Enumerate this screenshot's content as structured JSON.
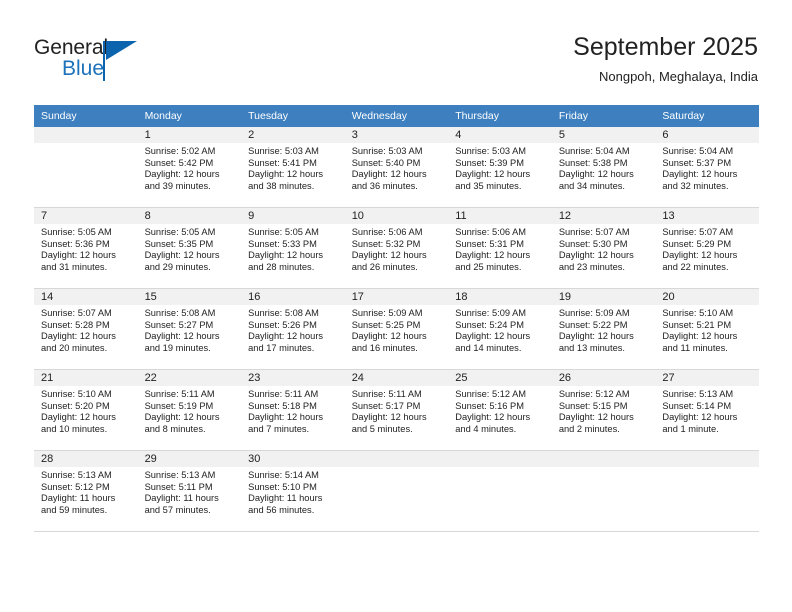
{
  "brand": {
    "name_part1": "General",
    "name_part2": "Blue",
    "accent_color": "#0b64ad",
    "logo_icon": "triangle-flag-icon"
  },
  "header": {
    "title": "September 2025",
    "location": "Nongpoh, Meghalaya, India"
  },
  "calendar": {
    "header_bg": "#3d7fbf",
    "daynum_bg": "#f1f1f1",
    "weekday_headers": [
      "Sunday",
      "Monday",
      "Tuesday",
      "Wednesday",
      "Thursday",
      "Friday",
      "Saturday"
    ],
    "weeks": [
      [
        {
          "day": "",
          "sunrise": "",
          "sunset": "",
          "daylight_line1": "",
          "daylight_line2": ""
        },
        {
          "day": "1",
          "sunrise": "Sunrise: 5:02 AM",
          "sunset": "Sunset: 5:42 PM",
          "daylight_line1": "Daylight: 12 hours",
          "daylight_line2": "and 39 minutes."
        },
        {
          "day": "2",
          "sunrise": "Sunrise: 5:03 AM",
          "sunset": "Sunset: 5:41 PM",
          "daylight_line1": "Daylight: 12 hours",
          "daylight_line2": "and 38 minutes."
        },
        {
          "day": "3",
          "sunrise": "Sunrise: 5:03 AM",
          "sunset": "Sunset: 5:40 PM",
          "daylight_line1": "Daylight: 12 hours",
          "daylight_line2": "and 36 minutes."
        },
        {
          "day": "4",
          "sunrise": "Sunrise: 5:03 AM",
          "sunset": "Sunset: 5:39 PM",
          "daylight_line1": "Daylight: 12 hours",
          "daylight_line2": "and 35 minutes."
        },
        {
          "day": "5",
          "sunrise": "Sunrise: 5:04 AM",
          "sunset": "Sunset: 5:38 PM",
          "daylight_line1": "Daylight: 12 hours",
          "daylight_line2": "and 34 minutes."
        },
        {
          "day": "6",
          "sunrise": "Sunrise: 5:04 AM",
          "sunset": "Sunset: 5:37 PM",
          "daylight_line1": "Daylight: 12 hours",
          "daylight_line2": "and 32 minutes."
        }
      ],
      [
        {
          "day": "7",
          "sunrise": "Sunrise: 5:05 AM",
          "sunset": "Sunset: 5:36 PM",
          "daylight_line1": "Daylight: 12 hours",
          "daylight_line2": "and 31 minutes."
        },
        {
          "day": "8",
          "sunrise": "Sunrise: 5:05 AM",
          "sunset": "Sunset: 5:35 PM",
          "daylight_line1": "Daylight: 12 hours",
          "daylight_line2": "and 29 minutes."
        },
        {
          "day": "9",
          "sunrise": "Sunrise: 5:05 AM",
          "sunset": "Sunset: 5:33 PM",
          "daylight_line1": "Daylight: 12 hours",
          "daylight_line2": "and 28 minutes."
        },
        {
          "day": "10",
          "sunrise": "Sunrise: 5:06 AM",
          "sunset": "Sunset: 5:32 PM",
          "daylight_line1": "Daylight: 12 hours",
          "daylight_line2": "and 26 minutes."
        },
        {
          "day": "11",
          "sunrise": "Sunrise: 5:06 AM",
          "sunset": "Sunset: 5:31 PM",
          "daylight_line1": "Daylight: 12 hours",
          "daylight_line2": "and 25 minutes."
        },
        {
          "day": "12",
          "sunrise": "Sunrise: 5:07 AM",
          "sunset": "Sunset: 5:30 PM",
          "daylight_line1": "Daylight: 12 hours",
          "daylight_line2": "and 23 minutes."
        },
        {
          "day": "13",
          "sunrise": "Sunrise: 5:07 AM",
          "sunset": "Sunset: 5:29 PM",
          "daylight_line1": "Daylight: 12 hours",
          "daylight_line2": "and 22 minutes."
        }
      ],
      [
        {
          "day": "14",
          "sunrise": "Sunrise: 5:07 AM",
          "sunset": "Sunset: 5:28 PM",
          "daylight_line1": "Daylight: 12 hours",
          "daylight_line2": "and 20 minutes."
        },
        {
          "day": "15",
          "sunrise": "Sunrise: 5:08 AM",
          "sunset": "Sunset: 5:27 PM",
          "daylight_line1": "Daylight: 12 hours",
          "daylight_line2": "and 19 minutes."
        },
        {
          "day": "16",
          "sunrise": "Sunrise: 5:08 AM",
          "sunset": "Sunset: 5:26 PM",
          "daylight_line1": "Daylight: 12 hours",
          "daylight_line2": "and 17 minutes."
        },
        {
          "day": "17",
          "sunrise": "Sunrise: 5:09 AM",
          "sunset": "Sunset: 5:25 PM",
          "daylight_line1": "Daylight: 12 hours",
          "daylight_line2": "and 16 minutes."
        },
        {
          "day": "18",
          "sunrise": "Sunrise: 5:09 AM",
          "sunset": "Sunset: 5:24 PM",
          "daylight_line1": "Daylight: 12 hours",
          "daylight_line2": "and 14 minutes."
        },
        {
          "day": "19",
          "sunrise": "Sunrise: 5:09 AM",
          "sunset": "Sunset: 5:22 PM",
          "daylight_line1": "Daylight: 12 hours",
          "daylight_line2": "and 13 minutes."
        },
        {
          "day": "20",
          "sunrise": "Sunrise: 5:10 AM",
          "sunset": "Sunset: 5:21 PM",
          "daylight_line1": "Daylight: 12 hours",
          "daylight_line2": "and 11 minutes."
        }
      ],
      [
        {
          "day": "21",
          "sunrise": "Sunrise: 5:10 AM",
          "sunset": "Sunset: 5:20 PM",
          "daylight_line1": "Daylight: 12 hours",
          "daylight_line2": "and 10 minutes."
        },
        {
          "day": "22",
          "sunrise": "Sunrise: 5:11 AM",
          "sunset": "Sunset: 5:19 PM",
          "daylight_line1": "Daylight: 12 hours",
          "daylight_line2": "and 8 minutes."
        },
        {
          "day": "23",
          "sunrise": "Sunrise: 5:11 AM",
          "sunset": "Sunset: 5:18 PM",
          "daylight_line1": "Daylight: 12 hours",
          "daylight_line2": "and 7 minutes."
        },
        {
          "day": "24",
          "sunrise": "Sunrise: 5:11 AM",
          "sunset": "Sunset: 5:17 PM",
          "daylight_line1": "Daylight: 12 hours",
          "daylight_line2": "and 5 minutes."
        },
        {
          "day": "25",
          "sunrise": "Sunrise: 5:12 AM",
          "sunset": "Sunset: 5:16 PM",
          "daylight_line1": "Daylight: 12 hours",
          "daylight_line2": "and 4 minutes."
        },
        {
          "day": "26",
          "sunrise": "Sunrise: 5:12 AM",
          "sunset": "Sunset: 5:15 PM",
          "daylight_line1": "Daylight: 12 hours",
          "daylight_line2": "and 2 minutes."
        },
        {
          "day": "27",
          "sunrise": "Sunrise: 5:13 AM",
          "sunset": "Sunset: 5:14 PM",
          "daylight_line1": "Daylight: 12 hours",
          "daylight_line2": "and 1 minute."
        }
      ],
      [
        {
          "day": "28",
          "sunrise": "Sunrise: 5:13 AM",
          "sunset": "Sunset: 5:12 PM",
          "daylight_line1": "Daylight: 11 hours",
          "daylight_line2": "and 59 minutes."
        },
        {
          "day": "29",
          "sunrise": "Sunrise: 5:13 AM",
          "sunset": "Sunset: 5:11 PM",
          "daylight_line1": "Daylight: 11 hours",
          "daylight_line2": "and 57 minutes."
        },
        {
          "day": "30",
          "sunrise": "Sunrise: 5:14 AM",
          "sunset": "Sunset: 5:10 PM",
          "daylight_line1": "Daylight: 11 hours",
          "daylight_line2": "and 56 minutes."
        },
        {
          "day": "",
          "sunrise": "",
          "sunset": "",
          "daylight_line1": "",
          "daylight_line2": ""
        },
        {
          "day": "",
          "sunrise": "",
          "sunset": "",
          "daylight_line1": "",
          "daylight_line2": ""
        },
        {
          "day": "",
          "sunrise": "",
          "sunset": "",
          "daylight_line1": "",
          "daylight_line2": ""
        },
        {
          "day": "",
          "sunrise": "",
          "sunset": "",
          "daylight_line1": "",
          "daylight_line2": ""
        }
      ]
    ]
  }
}
